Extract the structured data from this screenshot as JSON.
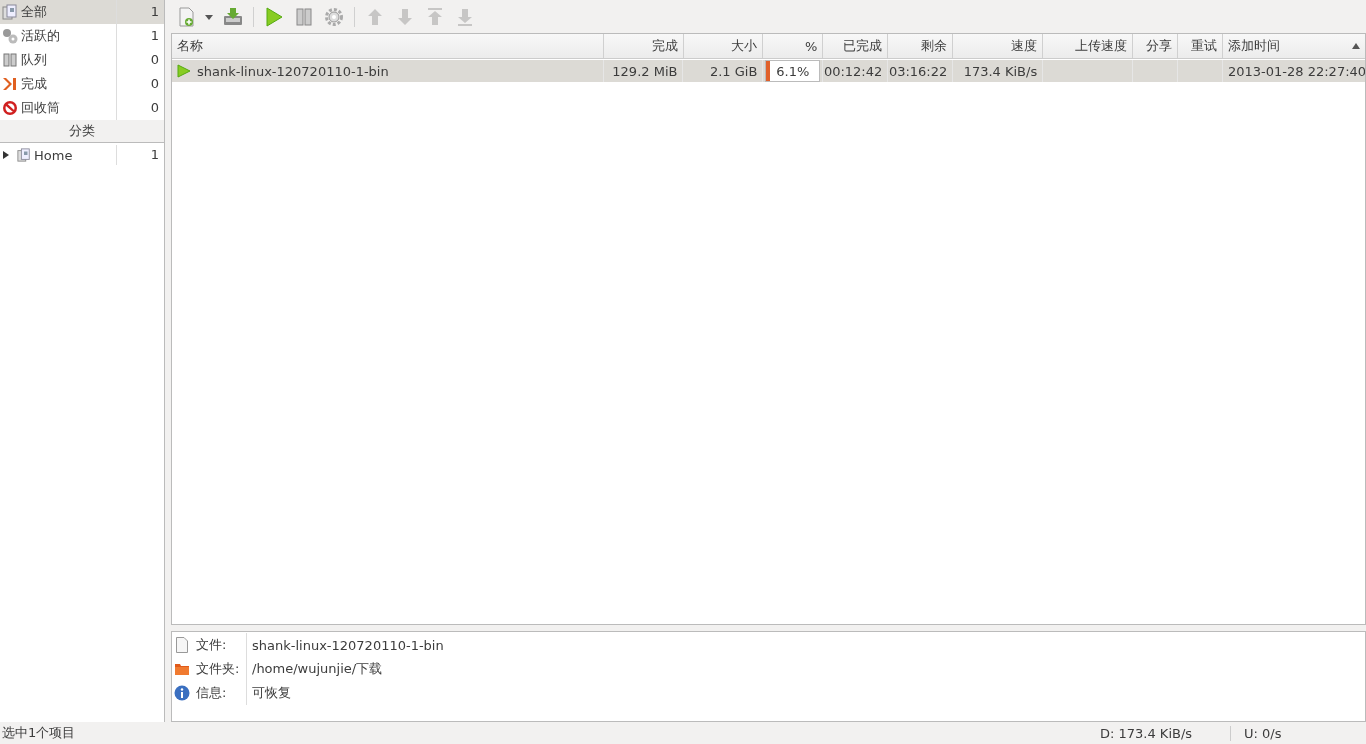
{
  "sidebar": {
    "items": [
      {
        "kind": "all",
        "label": "全部",
        "count": "1",
        "selected": true
      },
      {
        "kind": "active",
        "label": "活跃的",
        "count": "1",
        "selected": false
      },
      {
        "kind": "queue",
        "label": "队列",
        "count": "0",
        "selected": false
      },
      {
        "kind": "done",
        "label": "完成",
        "count": "0",
        "selected": false
      },
      {
        "kind": "trash",
        "label": "回收筒",
        "count": "0",
        "selected": false
      }
    ],
    "categories_title": "分类",
    "categories": [
      {
        "label": "Home",
        "count": "1",
        "expanded": false,
        "selected": false
      }
    ]
  },
  "toolbar": {
    "groups": [
      {
        "buttons": [
          {
            "kind": "add",
            "disabled": false
          },
          {
            "kind": "caret",
            "disabled": false
          },
          {
            "kind": "download",
            "disabled": false
          }
        ]
      },
      {
        "buttons": [
          {
            "kind": "play",
            "disabled": false
          },
          {
            "kind": "pause",
            "disabled": false
          },
          {
            "kind": "gear",
            "disabled": false
          }
        ]
      },
      {
        "buttons": [
          {
            "kind": "up",
            "disabled": true
          },
          {
            "kind": "down",
            "disabled": true
          },
          {
            "kind": "top",
            "disabled": true
          },
          {
            "kind": "bottom",
            "disabled": true
          }
        ]
      }
    ]
  },
  "table": {
    "columns": [
      {
        "label": "名称",
        "sorted": false
      },
      {
        "label": "完成",
        "sorted": false
      },
      {
        "label": "大小",
        "sorted": false
      },
      {
        "label": "%",
        "sorted": false
      },
      {
        "label": "已完成",
        "sorted": false
      },
      {
        "label": "剩余",
        "sorted": false
      },
      {
        "label": "速度",
        "sorted": false
      },
      {
        "label": "上传速度",
        "sorted": false
      },
      {
        "label": "分享",
        "sorted": false
      },
      {
        "label": "重试",
        "sorted": false
      },
      {
        "label": "添加时间",
        "sorted": true
      }
    ],
    "rows": [
      {
        "selected": true,
        "name": "shank-linux-120720110-1-bin",
        "done": "129.2 MiB",
        "size": "2.1 GiB",
        "percent": "6.1%",
        "level": 0.061,
        "elapsed": "00:12:42",
        "remaining": "03:16:22",
        "speed": "173.4 KiB/s",
        "added": "2013-01-28 22:27:40"
      }
    ]
  },
  "details": [
    {
      "kind": "file",
      "label": "文件:",
      "value": "shank-linux-120720110-1-bin"
    },
    {
      "kind": "folder",
      "label": "文件夹:",
      "value": "/home/wujunjie/下载"
    },
    {
      "kind": "info",
      "label": "信息:",
      "value": "可恢复"
    }
  ],
  "status_bar": {
    "selection": "选中1个项目",
    "download": "D:  173.4 KiB/s",
    "upload": "U:  0/s"
  }
}
